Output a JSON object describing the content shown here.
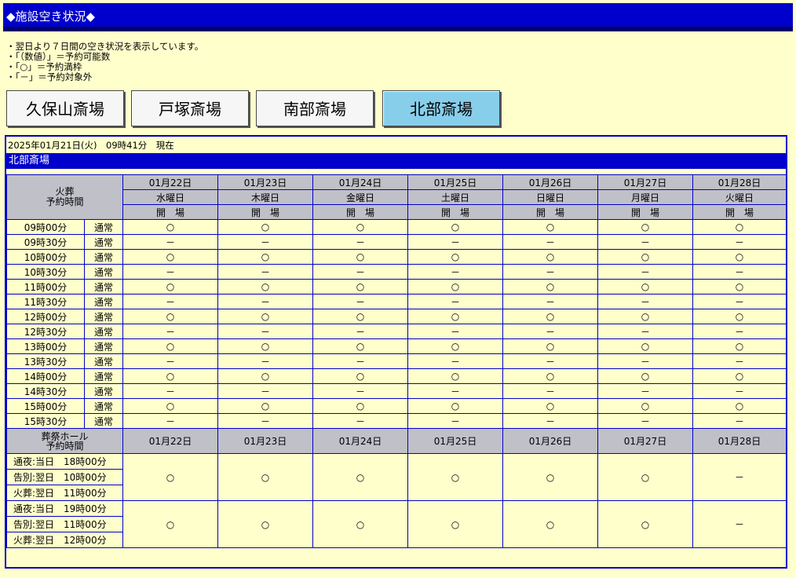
{
  "title": "◆施設空き状況◆",
  "notes": [
    "・翌日より７日間の空き状況を表示しています。",
    "・「（数値）」＝予約可能数",
    "・「○」＝予約満枠",
    "・「－」＝予約対象外"
  ],
  "tabs": [
    {
      "label": "久保山斎場",
      "active": false
    },
    {
      "label": "戸塚斎場",
      "active": false
    },
    {
      "label": "南部斎場",
      "active": false
    },
    {
      "label": "北部斎場",
      "active": true
    }
  ],
  "timestamp": "2025年01月21日(火)　09時41分　現在",
  "facility_name": "北部斎場",
  "cremation_header": "火葬\n予約時間",
  "dates": [
    "01月22日",
    "01月23日",
    "01月24日",
    "01月25日",
    "01月26日",
    "01月27日",
    "01月28日"
  ],
  "weekdays": [
    "水曜日",
    "木曜日",
    "金曜日",
    "土曜日",
    "日曜日",
    "月曜日",
    "火曜日"
  ],
  "status": [
    "開　場",
    "開　場",
    "開　場",
    "開　場",
    "開　場",
    "開　場",
    "開　場"
  ],
  "cremation_rows": [
    {
      "time": "09時00分",
      "type": "通常",
      "cells": [
        "○",
        "○",
        "○",
        "○",
        "○",
        "○",
        "○"
      ]
    },
    {
      "time": "09時30分",
      "type": "通常",
      "cells": [
        "－",
        "－",
        "－",
        "－",
        "－",
        "－",
        "－"
      ]
    },
    {
      "time": "10時00分",
      "type": "通常",
      "cells": [
        "○",
        "○",
        "○",
        "○",
        "○",
        "○",
        "○"
      ]
    },
    {
      "time": "10時30分",
      "type": "通常",
      "cells": [
        "－",
        "－",
        "－",
        "－",
        "－",
        "－",
        "－"
      ]
    },
    {
      "time": "11時00分",
      "type": "通常",
      "cells": [
        "○",
        "○",
        "○",
        "○",
        "○",
        "○",
        "○"
      ]
    },
    {
      "time": "11時30分",
      "type": "通常",
      "cells": [
        "－",
        "－",
        "－",
        "－",
        "－",
        "－",
        "－"
      ]
    },
    {
      "time": "12時00分",
      "type": "通常",
      "cells": [
        "○",
        "○",
        "○",
        "○",
        "○",
        "○",
        "○"
      ]
    },
    {
      "time": "12時30分",
      "type": "通常",
      "cells": [
        "－",
        "－",
        "－",
        "－",
        "－",
        "－",
        "－"
      ]
    },
    {
      "time": "13時00分",
      "type": "通常",
      "cells": [
        "○",
        "○",
        "○",
        "○",
        "○",
        "○",
        "○"
      ]
    },
    {
      "time": "13時30分",
      "type": "通常",
      "cells": [
        "－",
        "－",
        "－",
        "－",
        "－",
        "－",
        "－"
      ]
    },
    {
      "time": "14時00分",
      "type": "通常",
      "cells": [
        "○",
        "○",
        "○",
        "○",
        "○",
        "○",
        "○"
      ]
    },
    {
      "time": "14時30分",
      "type": "通常",
      "cells": [
        "－",
        "－",
        "－",
        "－",
        "－",
        "－",
        "－"
      ]
    },
    {
      "time": "15時00分",
      "type": "通常",
      "cells": [
        "○",
        "○",
        "○",
        "○",
        "○",
        "○",
        "○"
      ]
    },
    {
      "time": "15時30分",
      "type": "通常",
      "cells": [
        "－",
        "－",
        "－",
        "－",
        "－",
        "－",
        "－"
      ]
    }
  ],
  "hall_header": "葬祭ホール\n予約時間",
  "hall_rows": [
    {
      "times": [
        "通夜:当日　18時00分",
        "告別:翌日　10時00分",
        "火葬:翌日　11時00分"
      ],
      "cells": [
        "○",
        "○",
        "○",
        "○",
        "○",
        "○",
        "－"
      ]
    },
    {
      "times": [
        "通夜:当日　19時00分",
        "告別:翌日　11時00分",
        "火葬:翌日　12時00分"
      ],
      "cells": [
        "○",
        "○",
        "○",
        "○",
        "○",
        "○",
        "－"
      ]
    }
  ]
}
